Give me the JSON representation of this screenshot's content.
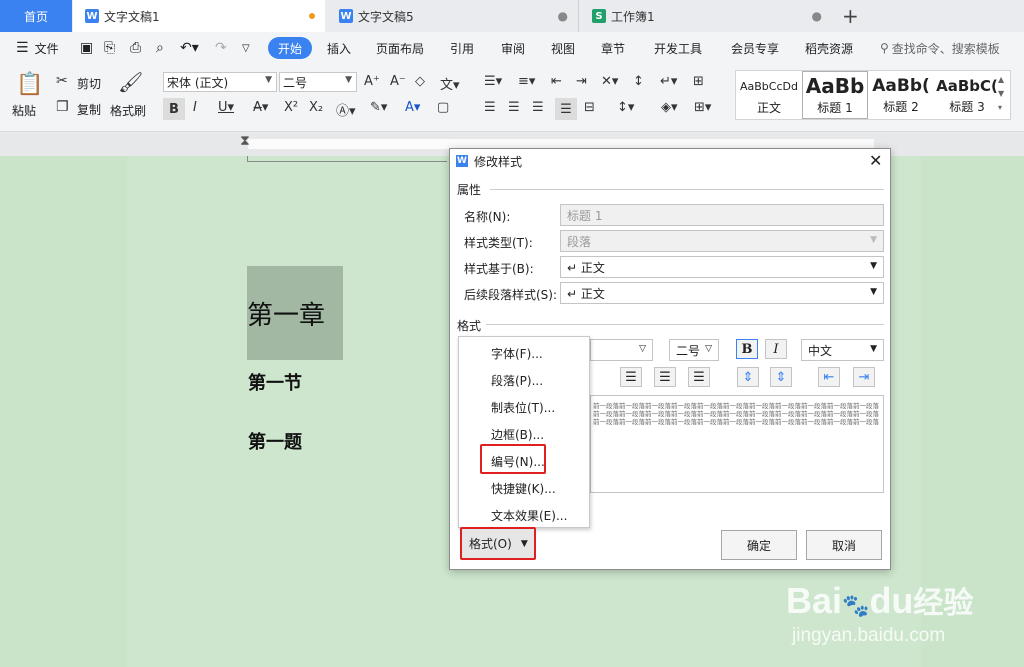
{
  "tabs": {
    "home": "首页",
    "doc1": "文字文稿1",
    "doc2": "文字文稿5",
    "sheet": "工作簿1",
    "doc_icon": "W",
    "sheet_icon": "S",
    "new_tab": "+"
  },
  "menubar": {
    "file": "文件",
    "start": "开始",
    "insert": "插入",
    "layout": "页面布局",
    "reference": "引用",
    "review": "审阅",
    "view": "视图",
    "section": "章节",
    "devtools": "开发工具",
    "vip": "会员专享",
    "daoke": "稻壳资源",
    "search": "查找命令、搜索模板"
  },
  "toolbar": {
    "paste": "粘贴",
    "cut": "剪切",
    "copy": "复制",
    "format_painter": "格式刷",
    "font": "宋体 (正文)",
    "size": "二号"
  },
  "styles": [
    {
      "preview": "AaBbCcDd",
      "name": "正文"
    },
    {
      "preview": "AaBb",
      "name": "标题 1"
    },
    {
      "preview": "AaBb(",
      "name": "标题 2"
    },
    {
      "preview": "AaBbC(",
      "name": "标题 3"
    }
  ],
  "document": {
    "chapter": "第一章",
    "section": "第一节",
    "question": "第一题"
  },
  "dialog": {
    "icon": "W",
    "title": "修改样式",
    "properties_label": "属性",
    "name_label": "名称(N):",
    "name_value": "标题 1",
    "type_label": "样式类型(T):",
    "type_value": "段落",
    "based_on_label": "样式基于(B):",
    "based_on_value": "↵ 正文",
    "next_label": "后续段落样式(S):",
    "next_value": "↵ 正文",
    "format_section": "格式",
    "size_value": "二号",
    "bold": "B",
    "italic": "I",
    "lang_value": "中文",
    "preview_text": "前一段落前一段落前一段落前一段落前一段落前一段落前一段落前一段落前一段落前一段落前一段落前一段落前一段落前一段落前一段落前一段落前一段落前一段落前一段落前一段落前一段落前一段落前一段落前一段落前一段落前一段落前一段落前一段落前一段落前一段落前一段落前一段落前一段落",
    "format_button": "格式(O)",
    "ok": "确定",
    "cancel": "取消"
  },
  "format_menu": [
    "字体(F)...",
    "段落(P)...",
    "制表位(T)...",
    "边框(B)...",
    "编号(N)...",
    "快捷键(K)...",
    "文本效果(E)..."
  ],
  "watermark": {
    "brand": "Bai",
    "brand2": "du",
    "jingyan": "经验",
    "url": "jingyan.baidu.com"
  },
  "colors": {
    "accent": "#3a82f0",
    "highlight": "#e02020",
    "page": "#cde6cd"
  }
}
